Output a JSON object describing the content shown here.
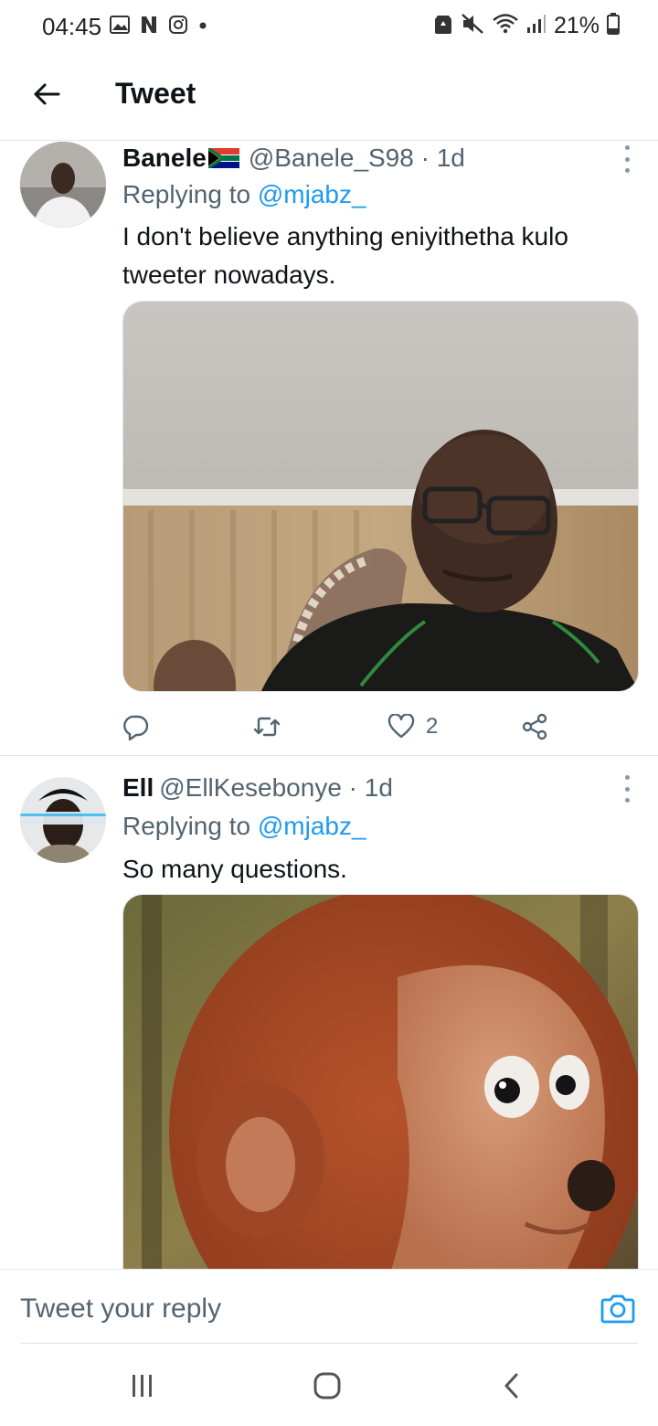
{
  "status_bar": {
    "time": "04:45",
    "battery": "21%",
    "left_icons": [
      "gallery-icon",
      "netflix-n-icon",
      "instagram-icon",
      "notification-dot-icon"
    ],
    "right_icons": [
      "recycle-icon",
      "mute-icon",
      "wifi-icon",
      "signal-icon",
      "battery-icon"
    ]
  },
  "header": {
    "back_icon": "arrow-left-icon",
    "title": "Tweet"
  },
  "tweets": [
    {
      "name": "Banele",
      "flag": "south-africa-flag",
      "meta": "@Banele_S98 · 1d",
      "replying_prefix": "Replying to ",
      "replying_to": "@mjabz_",
      "text": "I don't believe anything eniyithetha kulo tweeter nowadays.",
      "media": "photo-man-glasses",
      "actions": {
        "reply_count": "",
        "retweet_count": "",
        "like_count": "2"
      }
    },
    {
      "name": "Ell",
      "meta": "@EllKesebonye · 1d",
      "replying_prefix": "Replying to ",
      "replying_to": "@mjabz_",
      "text": "So many questions.",
      "media": "photo-furry-monkey-puppet"
    }
  ],
  "composer": {
    "placeholder": "Tweet your reply",
    "camera_icon": "camera-icon"
  },
  "nav": [
    "recents-icon",
    "home-icon",
    "back-icon"
  ],
  "colors": {
    "accent": "#1d9bf0",
    "secondary_text": "#536471",
    "primary_text": "#0f1419",
    "divider": "#e3e6e8"
  }
}
